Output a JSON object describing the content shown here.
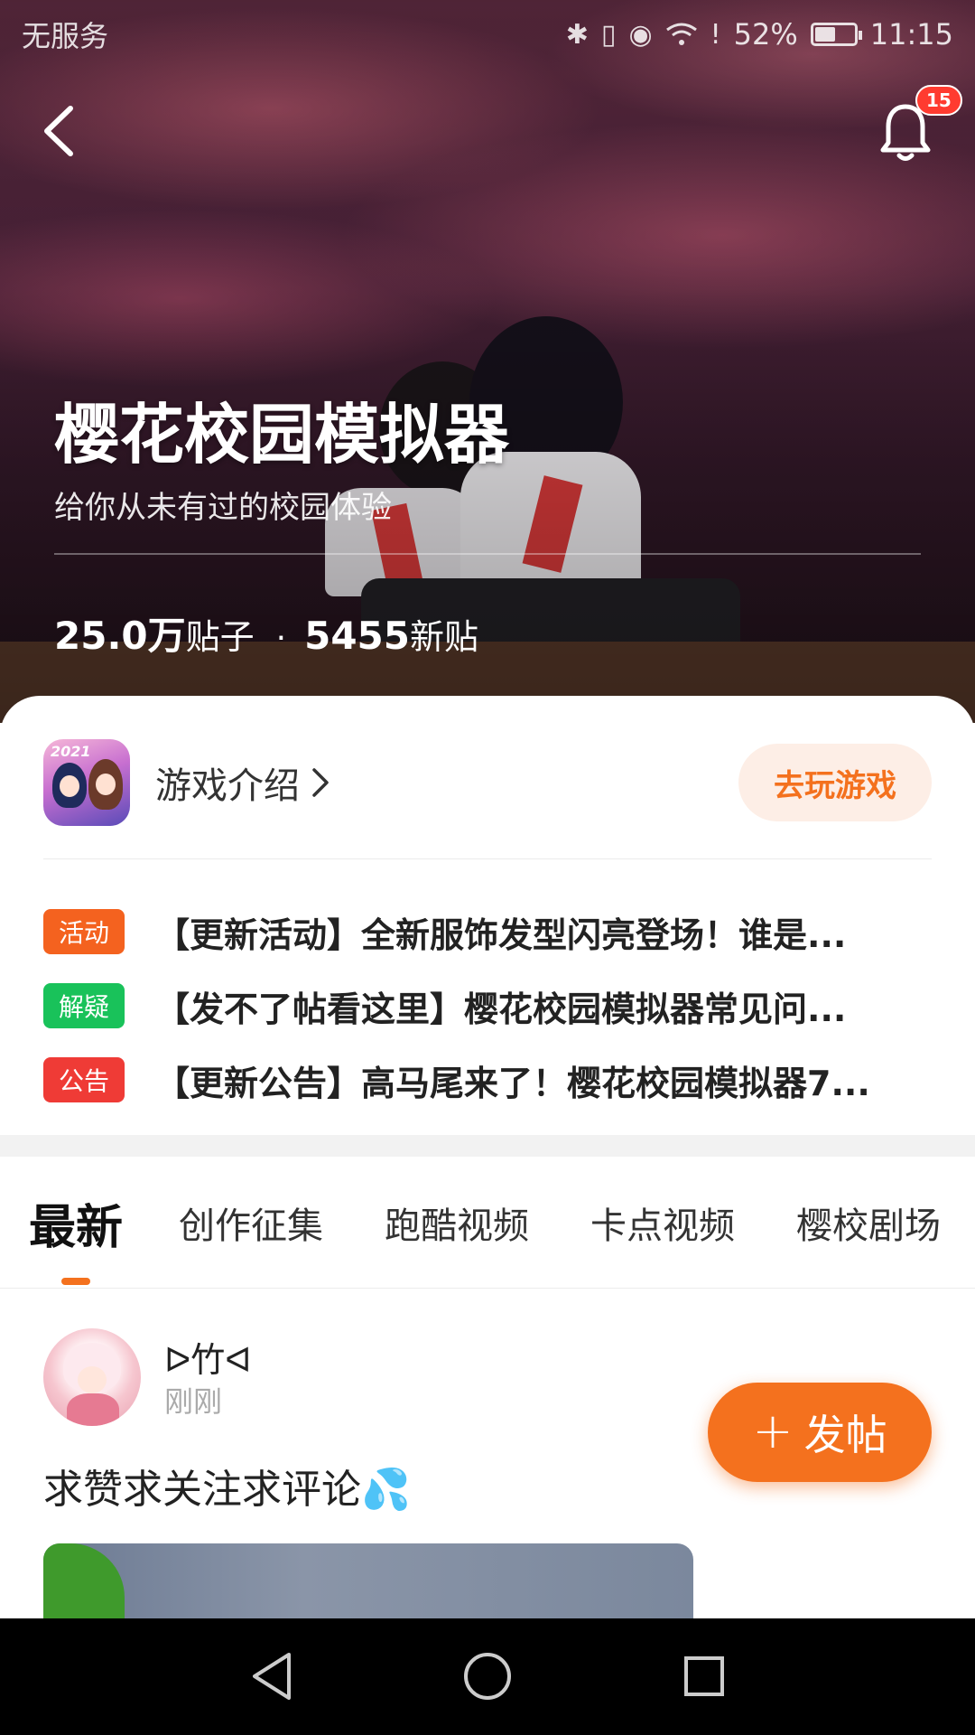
{
  "status_bar": {
    "carrier": "无服务",
    "battery_percent": "52%",
    "battery_level": 0.52,
    "time": "11:15",
    "icons": [
      "bluetooth-icon",
      "vibrate-icon",
      "eye-comfort-icon",
      "wifi-icon",
      "sim-alert-icon",
      "battery-icon"
    ]
  },
  "header": {
    "back_icon": "chevron-left-icon",
    "notification_icon": "bell-icon",
    "notification_count": "15"
  },
  "hero": {
    "title": "樱花校园模拟器",
    "subtitle": "给你从未有过的校园体验",
    "posts_count": "25.0万",
    "posts_label": "贴子",
    "separator": "·",
    "new_posts_count": "5455",
    "new_posts_label": "新贴"
  },
  "game": {
    "icon_year": "2021",
    "intro_label": "游戏介绍",
    "play_button": "去玩游戏"
  },
  "notices": [
    {
      "tag": "活动",
      "tag_color": "#f4621f",
      "text": "【更新活动】全新服饰发型闪亮登场！谁是..."
    },
    {
      "tag": "解疑",
      "tag_color": "#19c25a",
      "text": "【发不了帖看这里】樱花校园模拟器常见问..."
    },
    {
      "tag": "公告",
      "tag_color": "#ef3b36",
      "text": "【更新公告】高马尾来了！樱花校园模拟器7..."
    }
  ],
  "tabs": [
    {
      "label": "最新",
      "active": true
    },
    {
      "label": "创作征集",
      "active": false
    },
    {
      "label": "跑酷视频",
      "active": false
    },
    {
      "label": "卡点视频",
      "active": false
    },
    {
      "label": "樱校剧场",
      "active": false
    }
  ],
  "post": {
    "author": "ᐅ竹ᐊ",
    "time": "刚刚",
    "text": "求赞求关注求评论💦"
  },
  "fab": {
    "icon": "plus-icon",
    "label": "发帖"
  },
  "nav": {
    "back": "triangle-back-icon",
    "home": "circle-home-icon",
    "recents": "square-recents-icon"
  },
  "colors": {
    "accent": "#f4711e",
    "play_bg": "#fdeee6",
    "badge": "#ff3b30"
  }
}
